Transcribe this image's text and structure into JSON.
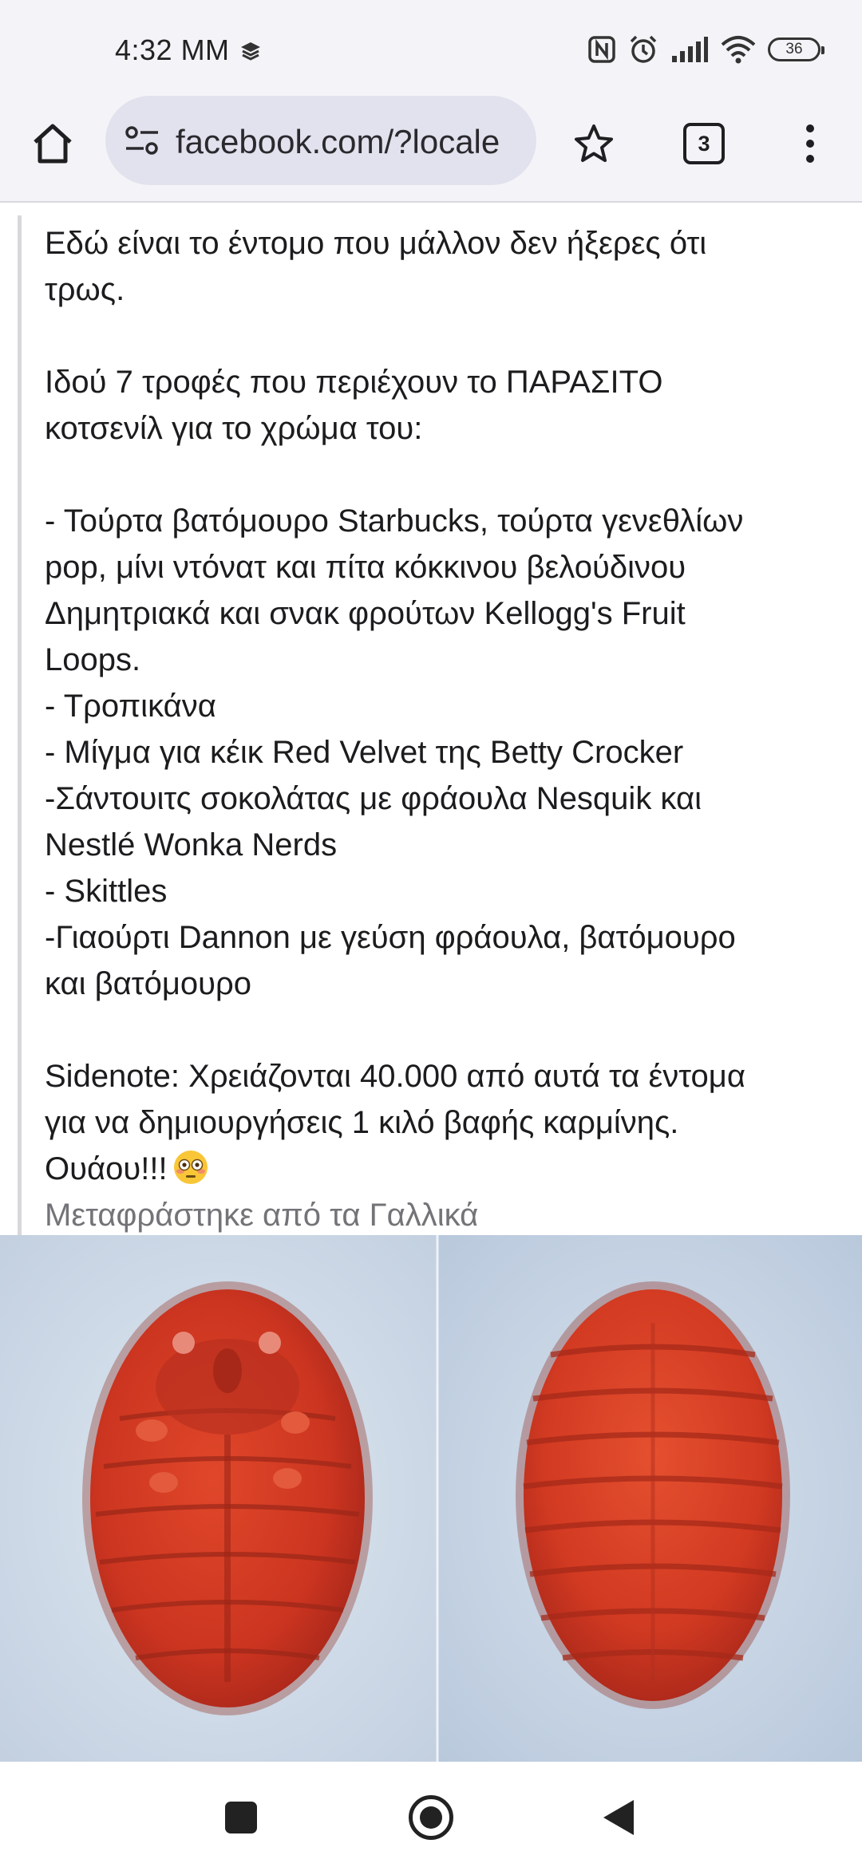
{
  "status_bar": {
    "time": "4:32 MM",
    "battery_level": "36",
    "icons": [
      "layers-icon",
      "nfc-icon",
      "alarm-icon",
      "signal-icon",
      "wifi-icon",
      "battery-icon"
    ]
  },
  "browser": {
    "url": "facebook.com/?locale",
    "tab_count": "3",
    "icons": [
      "home-icon",
      "site-settings-icon",
      "star-icon",
      "tabs-icon",
      "overflow-menu-icon"
    ]
  },
  "post": {
    "lines": [
      "Εδώ είναι το έντομο που μάλλον δεν ήξερες ότι",
      "τρως.",
      "",
      "Ιδού 7 τροφές που περιέχουν το ΠΑΡΑΣΙΤΟ",
      "κοτσενίλ για το χρώμα του:",
      "",
      "- Τούρτα βατόμουρο Starbucks, τούρτα γενεθλίων",
      "pop, μίνι ντόνατ και πίτα κόκκινου βελούδινου",
      "Δημητριακά και σνακ φρούτων Kellogg's Fruit",
      "Loops.",
      "- Τροπικάνα",
      "- Μίγμα για κέικ Red Velvet της Betty Crocker",
      "-Σάντουιτς σοκολάτας με φράουλα Nesquik και",
      "Nestlé Wonka Nerds",
      "- Skittles",
      "-Γιαούρτι Dannon με γεύση φράουλα, βατόμουρο",
      "και βατόμουρο",
      "",
      "Sidenote: Χρειάζονται 40.000 από αυτά τα έντομα",
      "για να δημιουργήσεις 1 κιλό βαφής καρμίνης.",
      "Ουάου!!!"
    ],
    "emoji": "flushed-face-emoji",
    "translated_label": "Μεταφράστηκε από τα Γαλλικά"
  },
  "image": {
    "subject": "cochineal-insects-photo"
  },
  "navigation_bar": {
    "icons": [
      "recents-icon",
      "home-circle-icon",
      "back-icon"
    ]
  },
  "colors": {
    "chrome_background": "#f4f4f8",
    "url_pill": "#e2e2ee",
    "translated_text": "#737378",
    "insect_red": "#d43a22"
  }
}
